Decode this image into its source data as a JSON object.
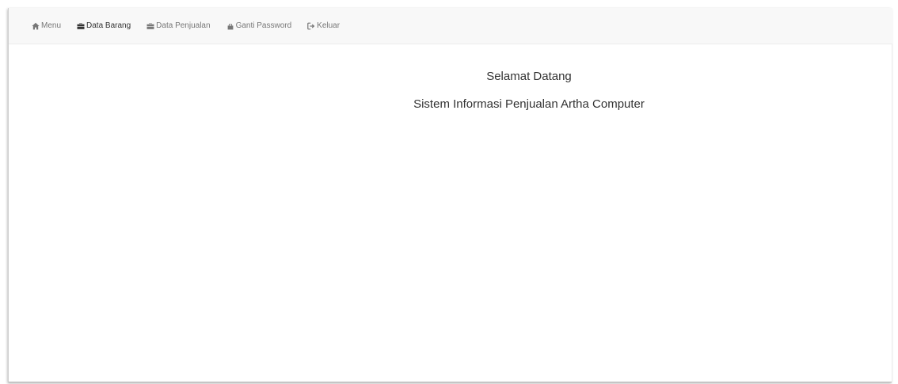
{
  "navbar": {
    "items": [
      {
        "label": "Menu",
        "icon": "home-icon",
        "active": false
      },
      {
        "label": "Data Barang",
        "icon": "briefcase-icon",
        "active": true
      },
      {
        "label": "Data Penjualan",
        "icon": "briefcase-icon",
        "active": false
      },
      {
        "label": "Ganti Password",
        "icon": "lock-icon",
        "active": false
      },
      {
        "label": "Keluar",
        "icon": "logout-icon",
        "active": false
      }
    ]
  },
  "main": {
    "welcome": "Selamat Datang",
    "subtitle": "Sistem Informasi Penjualan Artha Computer"
  },
  "colors": {
    "navbar_bg": "#f8f8f8",
    "nav_text": "#777777",
    "nav_active_text": "#333333",
    "body_text": "#333333"
  }
}
